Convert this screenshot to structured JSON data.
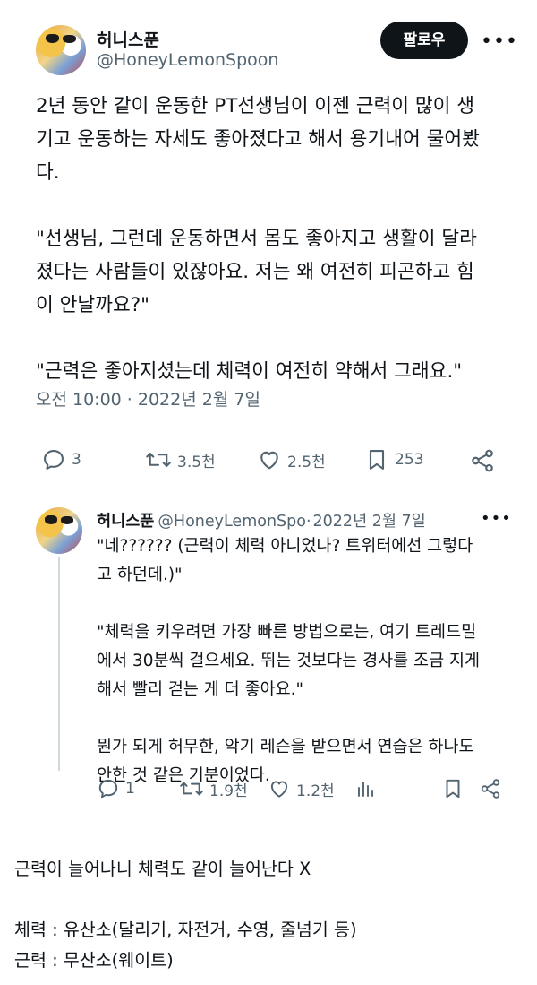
{
  "main_tweet": {
    "author_name": "허니스푼",
    "author_handle": "@HoneyLemonSpoon",
    "follow_label": "팔로우",
    "more_label": "•••",
    "text": "2년 동안 같이 운동한 PT선생님이 이젠 근력이 많이 생\n기고 운동하는 자세도 좋아졌다고 해서 용기내어 물어봤\n다.\n\n\"선생님, 그런데 운동하면서 몸도 좋아지고 생활이 달라\n졌다는 사람들이 있잖아요. 저는 왜 여전히 피곤하고 힘\n이 안날까요?\"\n\n\"근력은 좋아지셨는데 체력이 여전히 약해서 그래요.\"",
    "timestamp": "오전 10:00 · 2022년 2월 7일",
    "replies": "3",
    "retweets": "3.5천",
    "likes": "2.5천",
    "bookmarks": "253"
  },
  "reply_tweet": {
    "author_name": "허니스푼",
    "author_handle": "@HoneyLemonSpo·",
    "date": "2022년 2월 7일",
    "more_label": "•••",
    "text": "\"네?????? (근력이 체력 아니었나? 트위터에선 그렇다\n고 하던데.)\"\n\n\"체력을 키우려면 가장 빠른 방법으로는, 여기 트레드밀\n에서 30분씩 걸으세요. 뛰는 것보다는 경사를 조금 지게\n해서 빨리 걷는 게 더 좋아요.\"\n\n뭔가 되게 허무한, 악기 레슨을 받으면서 연습은 하나도\n안한 것 같은 기분이었다.",
    "replies": "1",
    "retweets": "1.9천",
    "likes": "1.2천"
  },
  "caption": {
    "line1": "근력이 늘어나니 체력도 같이 늘어난다 X",
    "line2": "체력 : 유산소(달리기, 자전거, 수영, 줄넘기 등)",
    "line3": "근력 : 무산소(웨이트)"
  }
}
